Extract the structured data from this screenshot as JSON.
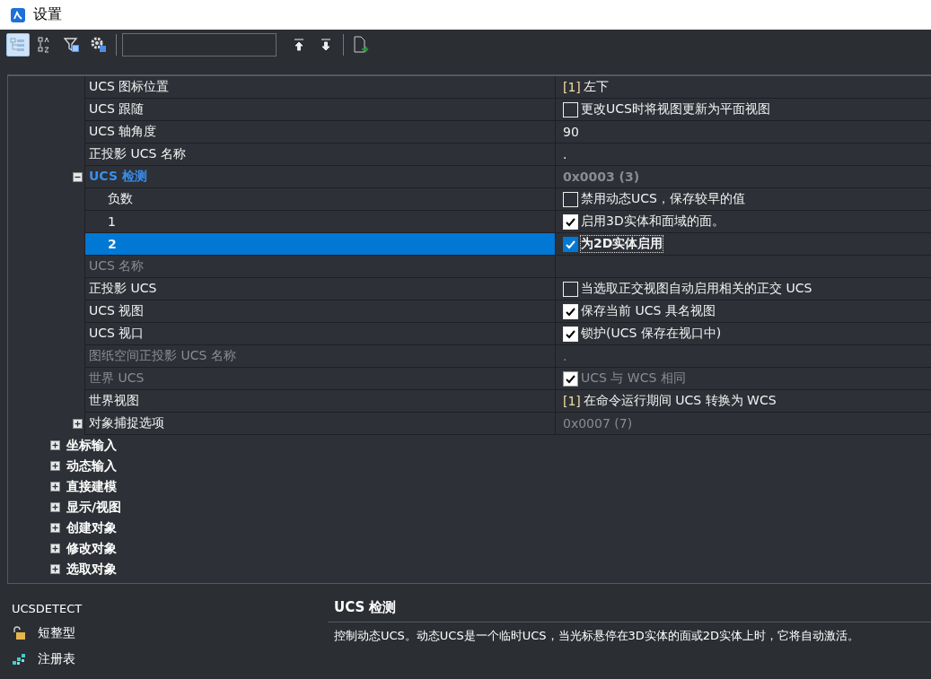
{
  "window": {
    "title": "设置"
  },
  "toolbar": {
    "buttons": [
      {
        "kind": "tree",
        "selected": true
      },
      {
        "kind": "sort",
        "selected": false
      },
      {
        "kind": "filter",
        "selected": false
      },
      {
        "kind": "gear",
        "selected": false
      }
    ]
  },
  "properties": [
    {
      "label": "UCS 图标位置",
      "kind": "text",
      "code": "[1]",
      "value": "左下",
      "disabled": false,
      "selected": false
    },
    {
      "label": "UCS 跟随",
      "kind": "check",
      "value": "更改UCS时将视图更新为平面视图",
      "checked": false,
      "disabled": false,
      "selected": false
    },
    {
      "label": "UCS 轴角度",
      "kind": "text",
      "value": "90",
      "disabled": false,
      "selected": false
    },
    {
      "label": "正投影 UCS 名称",
      "kind": "text",
      "value": ".",
      "disabled": false,
      "selected": false
    },
    {
      "label": "UCS 检测",
      "kind": "group",
      "value": "0x0003 (3)",
      "expanded": true,
      "disabled": false,
      "selected": false,
      "children": [
        {
          "label": "负数",
          "kind": "check",
          "value": "禁用动态UCS，保存较早的值",
          "checked": false,
          "disabled": false,
          "selected": false
        },
        {
          "label": "1",
          "kind": "check",
          "value": "启用3D实体和面域的面。",
          "checked": true,
          "disabled": false,
          "selected": false
        },
        {
          "label": "2",
          "kind": "check",
          "value": "为2D实体启用",
          "checked": true,
          "disabled": false,
          "selected": true
        }
      ]
    },
    {
      "label": "UCS 名称",
      "kind": "text",
      "disabled": true,
      "selected": false
    },
    {
      "label": "正投影 UCS",
      "kind": "check",
      "value": "当选取正交视图自动启用相关的正交 UCS",
      "checked": false,
      "disabled": false,
      "selected": false
    },
    {
      "label": "UCS 视图",
      "kind": "check",
      "value": "保存当前 UCS 具名视图",
      "checked": true,
      "disabled": false,
      "selected": false
    },
    {
      "label": "UCS 视口",
      "kind": "check",
      "value": "锁护(UCS 保存在视口中)",
      "checked": true,
      "disabled": false,
      "selected": false
    },
    {
      "label": "图纸空间正投影 UCS 名称",
      "kind": "text",
      "value": ".",
      "disabled": true,
      "selected": false
    },
    {
      "label": "世界 UCS",
      "kind": "check",
      "value": "UCS 与 WCS 相同",
      "checked": true,
      "disabled": true,
      "selected": false
    },
    {
      "label": "世界视图",
      "kind": "text",
      "code": "[1]",
      "value": "在命令运行期间 UCS 转换为 WCS",
      "disabled": false,
      "selected": false
    },
    {
      "label": "对象捕捉选项",
      "kind": "group",
      "value": "0x0007 (7)",
      "expanded": false,
      "disabled": false,
      "selected": false
    }
  ],
  "categories": [
    {
      "label": "坐标输入",
      "expanded": false
    },
    {
      "label": "动态输入",
      "expanded": false
    },
    {
      "label": "直接建模",
      "expanded": false
    },
    {
      "label": "显示/视图",
      "expanded": false
    },
    {
      "label": "创建对象",
      "expanded": false
    },
    {
      "label": "修改对象",
      "expanded": false
    },
    {
      "label": "选取对象",
      "expanded": false
    }
  ],
  "details": {
    "command": "UCSDETECT",
    "items": [
      {
        "kind": "lock",
        "label": "短整型"
      },
      {
        "kind": "registry",
        "label": "注册表"
      }
    ],
    "title": "UCS 检测",
    "description": "控制动态UCS。动态UCS是一个临时UCS，当光标悬停在3D实体的面或2D实体上时，它将自动激活。"
  }
}
